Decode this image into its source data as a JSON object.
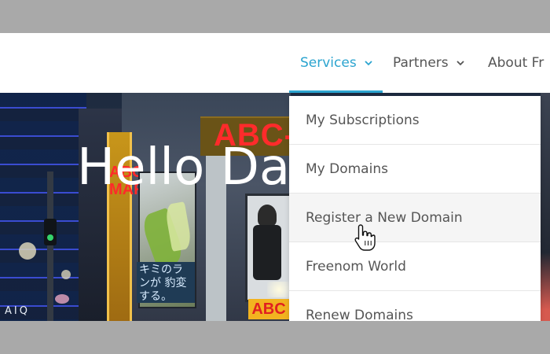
{
  "navbar": {
    "items": [
      {
        "label": "Services",
        "active": true
      },
      {
        "label": "Partners",
        "active": false
      },
      {
        "label": "About Fr",
        "active": false
      }
    ],
    "accent_color": "#2ba4cf"
  },
  "hero": {
    "title": "Hello Da",
    "sign_top": "ABC-",
    "sign_vertical": "ABC-MART",
    "billboard_text": "キミのランが 豹変する。",
    "sign_bottom": "ABC",
    "footer_text": "AIQ"
  },
  "dropdown": {
    "items": [
      {
        "label": "My Subscriptions"
      },
      {
        "label": "My Domains"
      },
      {
        "label": "Register a New Domain",
        "hovered": true
      },
      {
        "label": "Freenom World"
      },
      {
        "label": "Renew Domains"
      }
    ]
  },
  "cursor": {
    "icon": "hand-pointer-icon"
  }
}
